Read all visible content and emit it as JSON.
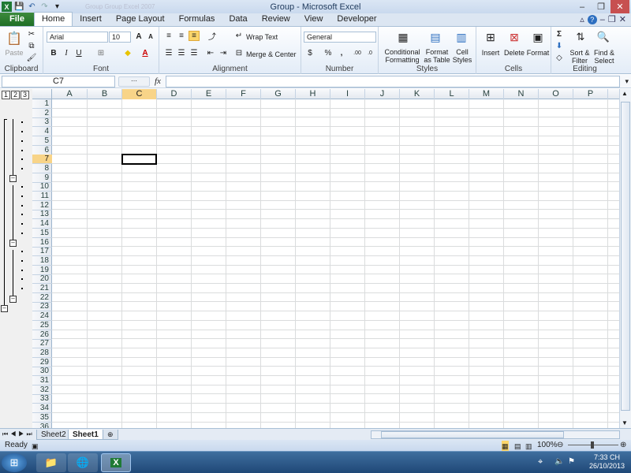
{
  "window": {
    "title": "Group  -  Microsoft Excel",
    "faded_doc": "Group Group Excel 2007"
  },
  "quick_access": {
    "save_icon": "save-icon",
    "undo_icon": "undo-icon",
    "redo_icon": "redo-icon"
  },
  "tabs": [
    "File",
    "Home",
    "Insert",
    "Page Layout",
    "Formulas",
    "Data",
    "Review",
    "View",
    "Developer"
  ],
  "active_tab": "Home",
  "ribbon": {
    "clipboard": {
      "label": "Clipboard",
      "paste": "Paste"
    },
    "font": {
      "label": "Font",
      "family": "Arial",
      "size": "10"
    },
    "alignment": {
      "label": "Alignment",
      "wrap": "Wrap Text",
      "merge": "Merge & Center"
    },
    "number": {
      "label": "Number",
      "format": "General"
    },
    "styles": {
      "label": "Styles",
      "cond1": "Conditional",
      "cond2": "Formatting",
      "fmt1": "Format",
      "fmt2": "as Table",
      "cell1": "Cell",
      "cell2": "Styles"
    },
    "cells": {
      "label": "Cells",
      "insert": "Insert",
      "delete": "Delete",
      "format": "Format"
    },
    "editing": {
      "label": "Editing",
      "sort1": "Sort &",
      "sort2": "Filter",
      "find1": "Find &",
      "find2": "Select"
    }
  },
  "formula_bar": {
    "name_box": "C7",
    "fx": "fx",
    "value": ""
  },
  "columns": [
    "A",
    "B",
    "C",
    "D",
    "E",
    "F",
    "G",
    "H",
    "I",
    "J",
    "K",
    "L",
    "M",
    "N",
    "O",
    "P"
  ],
  "rows": [
    "1",
    "2",
    "3",
    "4",
    "5",
    "6",
    "7",
    "8",
    "9",
    "10",
    "11",
    "12",
    "13",
    "14",
    "15",
    "16",
    "17",
    "18",
    "19",
    "20",
    "21",
    "22",
    "23",
    "24",
    "25",
    "26",
    "27",
    "28",
    "29",
    "30",
    "31",
    "32",
    "33",
    "34",
    "35",
    "36"
  ],
  "selected_cell": {
    "col": "C",
    "row": "7"
  },
  "outline_levels": [
    "1",
    "2",
    "3"
  ],
  "sheets": [
    "Sheet2",
    "Sheet1"
  ],
  "active_sheet": "Sheet1",
  "status": {
    "ready": "Ready",
    "zoom": "100%"
  },
  "tray": {
    "time": "7:33 CH",
    "date": "26/10/2013"
  }
}
